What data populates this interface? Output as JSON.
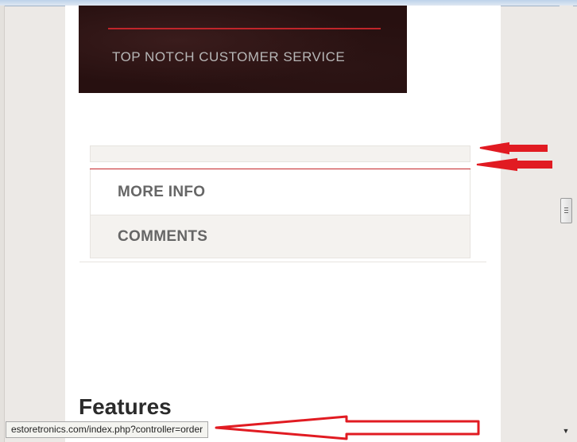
{
  "banner": {
    "text": "TOP NOTCH CUSTOMER SERVICE"
  },
  "tabs": [
    {
      "label": "MORE INFO"
    },
    {
      "label": "COMMENTS"
    }
  ],
  "section": {
    "heading": "Features"
  },
  "status_bar": {
    "url": "estoretronics.com/index.php?controller=order"
  },
  "colors": {
    "accent_red": "#c5262b",
    "annotation_red": "#e11b22",
    "banner_bg": "#271010"
  }
}
